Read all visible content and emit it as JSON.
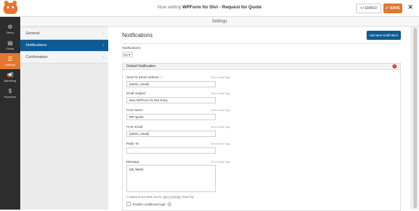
{
  "header": {
    "title_prefix": "Now editing",
    "title_form": "WPForm for Divi - Request for Quote",
    "embed_label": "<> EMBED",
    "save_label": "✔ SAVE",
    "close_glyph": "✕"
  },
  "sidebar": {
    "items": [
      {
        "label": "Setup",
        "icon": "gear-icon"
      },
      {
        "label": "Fields",
        "icon": "fields-icon"
      },
      {
        "label": "Settings",
        "icon": "sliders-icon"
      },
      {
        "label": "Marketing",
        "icon": "megaphone-icon"
      },
      {
        "label": "Payments",
        "icon": "dollar-icon"
      }
    ]
  },
  "subbar": {
    "title": "Settings"
  },
  "tabs": [
    {
      "label": "General"
    },
    {
      "label": "Notifications"
    },
    {
      "label": "Confirmation"
    }
  ],
  "content": {
    "title": "Notifications",
    "add_button": "Add New Notification",
    "notifications_label": "Notifications",
    "notifications_value": "On ▾",
    "box_title": "Default Notification",
    "smart_tags": "Show Smart Tags",
    "fields": [
      {
        "label": "Send To Email Address",
        "value": "{admin_email}"
      },
      {
        "label": "Email Subject",
        "value": "New WPForm for Divi Entry"
      },
      {
        "label": "From Name",
        "value": "WP Ignitor"
      },
      {
        "label": "From Email",
        "value": "{admin_email}"
      },
      {
        "label": "Reply-To",
        "value": ""
      }
    ],
    "message_label": "Message",
    "message_value": "{all_fields}",
    "help_prefix": "To display all form fields, use the",
    "help_code": "{all_fields}",
    "help_suffix": "Smart Tag.",
    "conditional_label": "Enable conditional logic"
  },
  "colors": {
    "accent": "#e27730",
    "active_tab": "#0e5a93",
    "sidebar_bg": "#2d2d2d"
  }
}
